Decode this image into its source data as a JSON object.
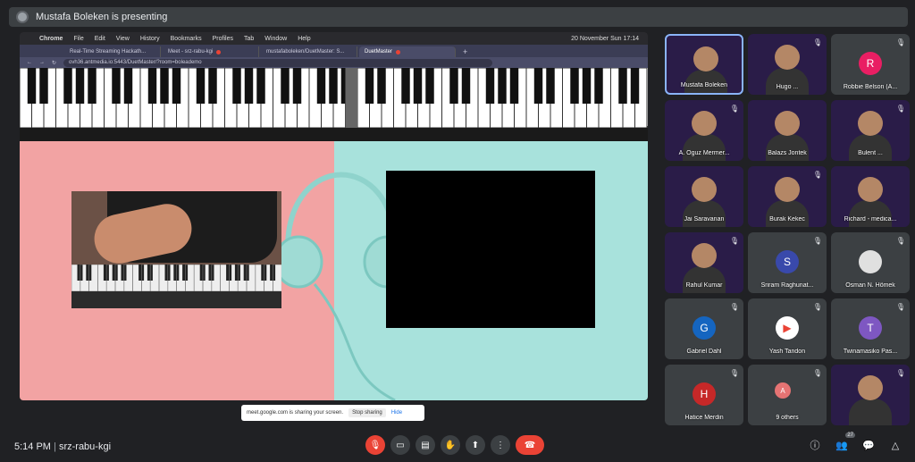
{
  "banner": {
    "presenting_text": "Mustafa Boleken is presenting"
  },
  "shared_screen": {
    "menubar": {
      "app": "Chrome",
      "menus": [
        "File",
        "Edit",
        "View",
        "History",
        "Bookmarks",
        "Profiles",
        "Tab",
        "Window",
        "Help"
      ],
      "clock": "20 November Sun  17:14"
    },
    "tabs": [
      {
        "label": "Real-Time Streaming Hackath..."
      },
      {
        "label": "Meet - srz-rabu-kgi"
      },
      {
        "label": "mustafaboleken/DuetMaster: S..."
      },
      {
        "label": "DuetMaster",
        "active": true
      }
    ],
    "url": "ovh36.antmedia.io:5443/DuetMaster/?room=boleademo",
    "share_notice": {
      "text": "meet.google.com is sharing your screen.",
      "stop": "Stop sharing",
      "hide": "Hide"
    }
  },
  "participants": [
    {
      "name": "Mustafa Boleken",
      "type": "video",
      "active": true
    },
    {
      "name": "Hugo ...",
      "type": "video"
    },
    {
      "name": "Robbie Belson (A...",
      "type": "initial",
      "initial": "R",
      "color": "#e91e63"
    },
    {
      "name": "A. Oguz Mermer...",
      "type": "video"
    },
    {
      "name": "Balazs Jontek",
      "type": "video"
    },
    {
      "name": "Bulent ...",
      "type": "video"
    },
    {
      "name": "Jai Saravanan",
      "type": "video"
    },
    {
      "name": "Burak Kekec",
      "type": "video"
    },
    {
      "name": "Richard - medica...",
      "type": "video"
    },
    {
      "name": "Rahul Kumar",
      "type": "video"
    },
    {
      "name": "Sriram Raghunat...",
      "type": "initial",
      "initial": "S",
      "color": "#3949ab"
    },
    {
      "name": "Osman N. Hömek",
      "type": "avatar"
    },
    {
      "name": "Gabriel Dahl",
      "type": "initial",
      "initial": "G",
      "color": "#1565c0"
    },
    {
      "name": "Yash Tandon",
      "type": "logo"
    },
    {
      "name": "Twinamasiko Pas...",
      "type": "initial",
      "initial": "T",
      "color": "#7e57c2"
    },
    {
      "name": "Hatice Merdin",
      "type": "initial",
      "initial": "H",
      "color": "#c62828"
    },
    {
      "name": "9 others",
      "type": "others"
    },
    {
      "name": "",
      "type": "video"
    }
  ],
  "footer": {
    "time": "5:14 PM",
    "separator": "|",
    "meeting_code": "srz-rabu-kgi",
    "people_count": "27"
  },
  "colors": {
    "accent_red": "#ea4335",
    "tile_bg": "#3c4043",
    "page_bg": "#202124"
  }
}
